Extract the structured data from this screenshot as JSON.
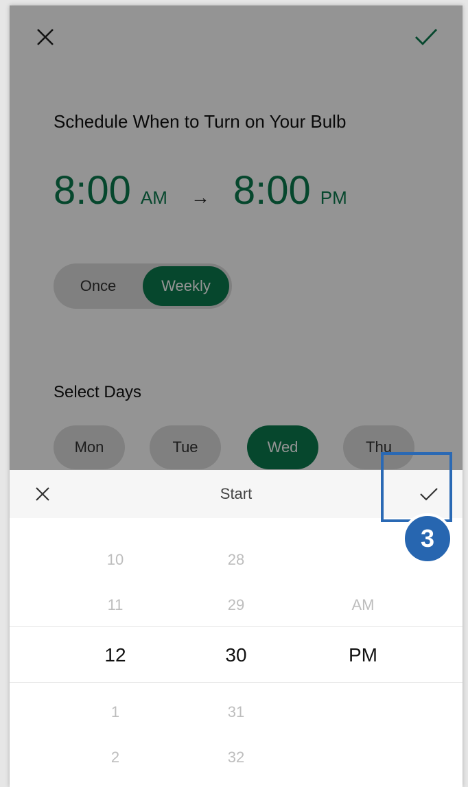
{
  "header": {
    "close_icon": "close-icon",
    "confirm_icon": "check-icon"
  },
  "schedule": {
    "title": "Schedule When to Turn on Your Bulb",
    "start_time": "8:00",
    "start_ampm": "AM",
    "arrow": "→",
    "end_time": "8:00",
    "end_ampm": "PM"
  },
  "repeat_toggle": {
    "once_label": "Once",
    "weekly_label": "Weekly",
    "selected": "Weekly"
  },
  "days": {
    "heading": "Select Days",
    "items": [
      {
        "label": "Mon",
        "selected": false
      },
      {
        "label": "Tue",
        "selected": false
      },
      {
        "label": "Wed",
        "selected": true
      },
      {
        "label": "Thu",
        "selected": false
      }
    ]
  },
  "sheet": {
    "title": "Start",
    "close_icon": "close-icon",
    "confirm_icon": "check-icon"
  },
  "picker": {
    "hours": [
      "10",
      "11",
      "12",
      "1",
      "2"
    ],
    "minutes": [
      "28",
      "29",
      "30",
      "31",
      "32"
    ],
    "period": [
      "",
      "AM",
      "PM",
      "",
      ""
    ],
    "selected": {
      "hour": "12",
      "minute": "30",
      "period": "PM"
    }
  },
  "annotation": {
    "step_number": "3"
  },
  "colors": {
    "accent": "#0b7a4f",
    "annotation": "#2766b0"
  }
}
